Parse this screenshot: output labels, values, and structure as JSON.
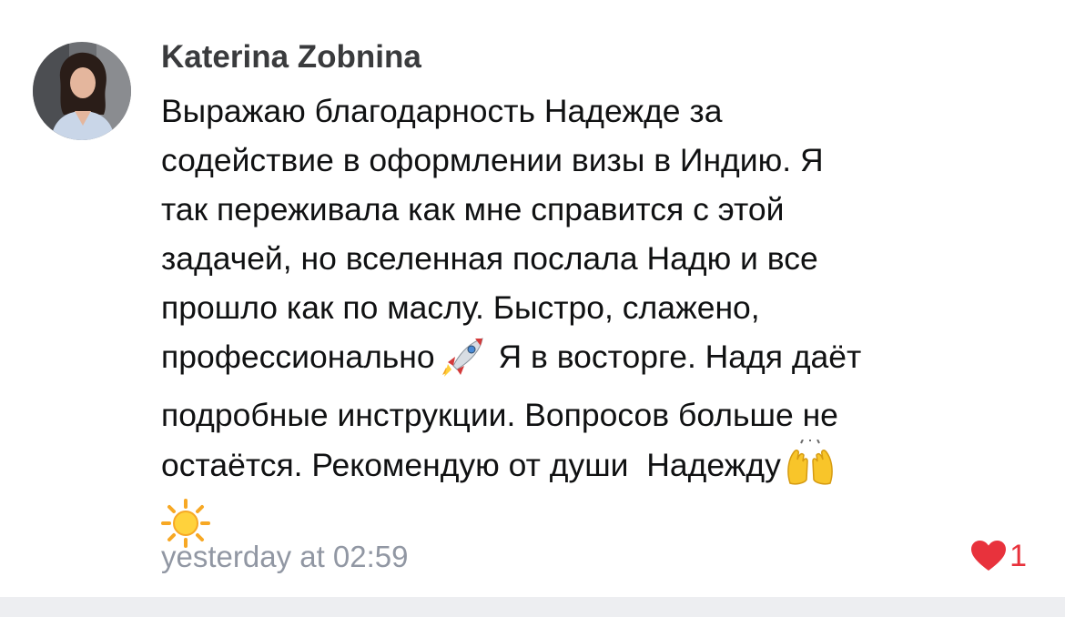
{
  "comment": {
    "author": "Katerina Zobnina",
    "text_1": "Выражаю благодарность Надежде за\nсодействие в оформлении визы в Индию. Я\nтак переживала как мне справится с этой\nзадачей, но вселенная послала Надю и все\nпрошло как по маслу. Быстро, слажено,\nпрофессионально",
    "text_2": " Я в восторге. Надя даёт\nподробные инструкции. Вопросов больше не\nостаётся. Рекомендую от души  Надежду",
    "text_3": "",
    "emoji": [
      "rocket-icon",
      "raising-hands-icon",
      "sun-icon"
    ],
    "timestamp": "yesterday at 02:59",
    "like_count": "1",
    "colors": {
      "author": "#3a3b3d",
      "text": "#101112",
      "timestamp": "#9197a3",
      "like": "#e8323c",
      "footer": "#edeef1"
    }
  }
}
